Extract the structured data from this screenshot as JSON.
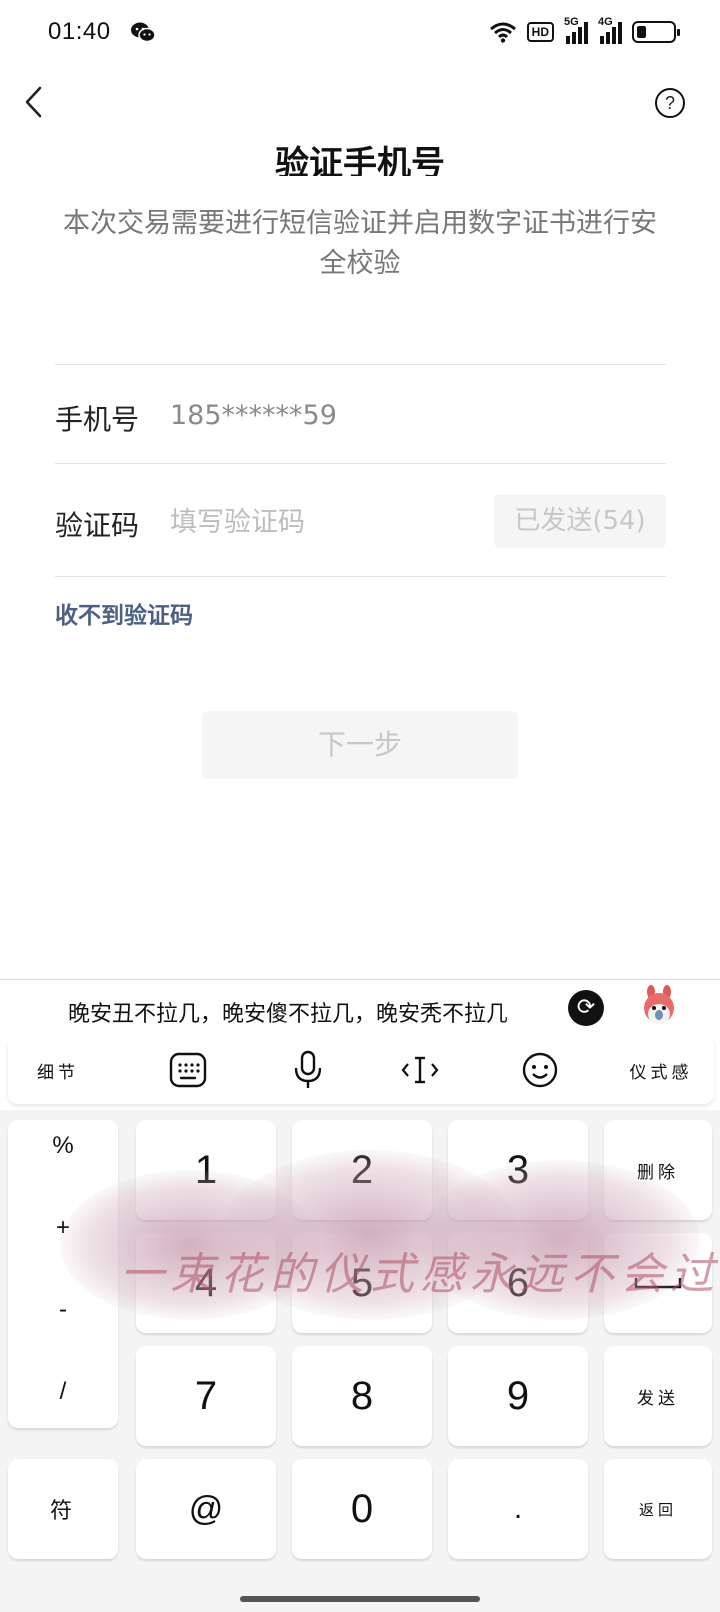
{
  "status_bar": {
    "time": "01:40",
    "hd_label": "HD",
    "sim1_label": "5G",
    "sim2_label": "4G",
    "battery_level": 0.25
  },
  "header": {
    "title": "验证手机号",
    "subtitle": "本次交易需要进行短信验证并启用数字证书进行安全校验",
    "help_label": "?"
  },
  "form": {
    "phone_label": "手机号",
    "phone_value": "185******59",
    "code_label": "验证码",
    "code_placeholder": "填写验证码",
    "code_value": "",
    "sent_button_label": "已发送(54)",
    "no_code_link": "收不到验证码",
    "next_button_label": "下一步"
  },
  "keyboard": {
    "suggestion": "晚安丑不拉几，晚安傻不拉几，晚安秃不拉几",
    "toolbar": {
      "left_label": "细节",
      "right_label": "仪式感"
    },
    "symbols": [
      "%",
      "+",
      "-",
      "/"
    ],
    "rows": [
      [
        "1",
        "2",
        "3"
      ],
      [
        "4",
        "5",
        "6"
      ],
      [
        "7",
        "8",
        "9"
      ]
    ],
    "bottom_keys": {
      "symbol_key": "符",
      "at_key": "@",
      "zero_key": "0",
      "dot_key": "."
    },
    "delete_label": "删除",
    "send_label": "发送",
    "return_label": "返回",
    "theme_text": "一束花的仪式感永远不会过时"
  }
}
